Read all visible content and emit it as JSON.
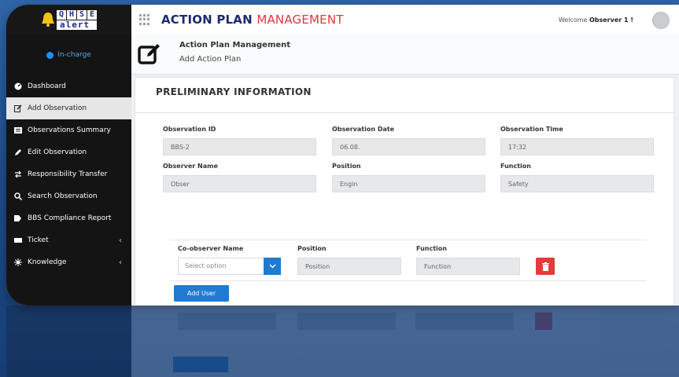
{
  "app": {
    "title_main": "ACTION PLAN",
    "title_accent": "MANAGEMENT",
    "welcome_prefix": "Welcome",
    "user": "Observer 1 !"
  },
  "logo": {
    "letters": [
      "Q",
      "H",
      "S",
      "E"
    ],
    "sub": "alert"
  },
  "sidebar": {
    "status": "In-charge",
    "items": [
      {
        "label": "Dashboard",
        "icon": "dashboard-icon"
      },
      {
        "label": "Add Observation",
        "icon": "edit-icon",
        "active": true
      },
      {
        "label": "Observations Summary",
        "icon": "summary-icon"
      },
      {
        "label": "Edit Observation",
        "icon": "pencil-icon"
      },
      {
        "label": "Responsibility Transfer",
        "icon": "transfer-icon"
      },
      {
        "label": "Search Observation",
        "icon": "search-icon"
      },
      {
        "label": "BBS Compliance Report",
        "icon": "report-icon"
      },
      {
        "label": "Ticket",
        "icon": "ticket-icon",
        "expandable": true
      },
      {
        "label": "Knowledge",
        "icon": "knowledge-icon",
        "expandable": true
      }
    ]
  },
  "page": {
    "title": "Action Plan Management",
    "subtitle": "Add Action Plan"
  },
  "form": {
    "section_title": "PRELIMINARY INFORMATION",
    "observation_id": {
      "label": "Observation ID",
      "value": "BBS-2"
    },
    "observation_date": {
      "label": "Observation Date",
      "value": "06.08."
    },
    "observation_time": {
      "label": "Observation Time",
      "value": "17:32"
    },
    "observer_name": {
      "label": "Observer Name",
      "value": "Obser"
    },
    "position": {
      "label": "Position",
      "value": "Engin"
    },
    "function": {
      "label": "Function",
      "value": "Safety"
    }
  },
  "coobserver": {
    "name_label": "Co-observer Name",
    "name_placeholder": "Select option",
    "position_label": "Position",
    "position_placeholder": "Position",
    "function_label": "Function",
    "function_placeholder": "Function",
    "add_button": "Add User"
  },
  "colors": {
    "accent": "#1f7bd1",
    "danger": "#e23b3b",
    "brand": "#1c2b6b",
    "brand_accent": "#e2363c",
    "sidebar": "#141414"
  }
}
